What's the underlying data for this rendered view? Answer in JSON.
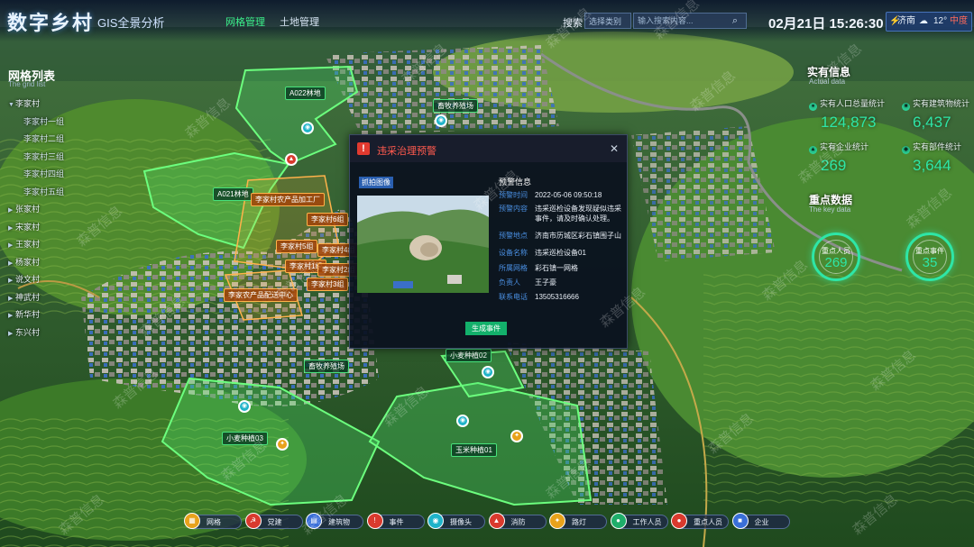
{
  "header": {
    "logo": "数字乡村",
    "subtitle": "GIS全景分析",
    "tabs": [
      {
        "label": "网格管理",
        "active": true
      },
      {
        "label": "土地管理",
        "active": false
      }
    ],
    "search": {
      "label": "搜索",
      "select_placeholder": "选择类别",
      "input_placeholder": "输入搜索内容..."
    },
    "datetime": "02月21日 15:26:30",
    "weather": {
      "city": "济南",
      "temp": "12°",
      "aqi": "中度"
    }
  },
  "left_panel": {
    "title": "网格列表",
    "subtitle": "The grid list",
    "items": [
      {
        "label": "李家村",
        "sub": false,
        "expanded": true
      },
      {
        "label": "李家村一组",
        "sub": true
      },
      {
        "label": "李家村二组",
        "sub": true
      },
      {
        "label": "李家村三组",
        "sub": true
      },
      {
        "label": "李家村四组",
        "sub": true
      },
      {
        "label": "李家村五组",
        "sub": true
      },
      {
        "label": "张家村",
        "sub": false
      },
      {
        "label": "宋家村",
        "sub": false
      },
      {
        "label": "王家村",
        "sub": false
      },
      {
        "label": "杨家村",
        "sub": false
      },
      {
        "label": "说文村",
        "sub": false
      },
      {
        "label": "神武村",
        "sub": false
      },
      {
        "label": "新华村",
        "sub": false
      },
      {
        "label": "东兴村",
        "sub": false
      }
    ]
  },
  "right_panel": {
    "actual_title": "实有信息",
    "actual_sub": "Actual data",
    "stats": [
      {
        "label": "实有人口总量统计",
        "value": "124,873",
        "icon": "people-icon"
      },
      {
        "label": "实有建筑物统计",
        "value": "6,437",
        "icon": "building-icon"
      },
      {
        "label": "实有企业统计",
        "value": "269",
        "icon": "company-icon"
      },
      {
        "label": "实有部件统计",
        "value": "3,644",
        "icon": "component-icon"
      }
    ],
    "key_title": "重点数据",
    "key_sub": "The key data",
    "key_rings": [
      {
        "label": "重点人员",
        "value": "269"
      },
      {
        "label": "重点事件",
        "value": "35"
      }
    ]
  },
  "map_labels": [
    {
      "text": "A022林地",
      "style": "green"
    },
    {
      "text": "畜牧养殖场",
      "style": "green"
    },
    {
      "text": "A021林地",
      "style": "green"
    },
    {
      "text": "李家村农产品加工厂",
      "style": "orange"
    },
    {
      "text": "李家村6组",
      "style": "orange"
    },
    {
      "text": "李家村5组",
      "style": "orange"
    },
    {
      "text": "李家村4组",
      "style": "orange"
    },
    {
      "text": "李家村1组",
      "style": "orange"
    },
    {
      "text": "李家村2组",
      "style": "orange"
    },
    {
      "text": "李家村3组",
      "style": "orange"
    },
    {
      "text": "李家农产品配送中心",
      "style": "orange"
    },
    {
      "text": "畜牧养殖场",
      "style": "green"
    },
    {
      "text": "小麦种植02",
      "style": "green"
    },
    {
      "text": "小麦种植03",
      "style": "green"
    },
    {
      "text": "玉米种植01",
      "style": "green"
    }
  ],
  "dialog": {
    "title": "违采治理预警",
    "photo_tag": "抓拍图像",
    "info_title": "预警信息",
    "rows": [
      {
        "key": "预警时间",
        "value": "2022-05-06  09:50:18"
      },
      {
        "key": "预警内容",
        "value": "违采巡检设备发现疑似违采事件，请及时确认处理。"
      },
      {
        "key": "预警地点",
        "value": "济南市历城区彩石镇围子山"
      },
      {
        "key": "设备名称",
        "value": "违采巡检设备01"
      },
      {
        "key": "所属网格",
        "value": "彩石镇一网格"
      },
      {
        "key": "负责人",
        "value": "王子豪"
      },
      {
        "key": "联系电话",
        "value": "13505316666"
      }
    ],
    "button": "生成事件"
  },
  "toolbar": [
    {
      "label": "网格",
      "color": "#e8a21b",
      "icon": "grid-icon",
      "glyph": "▦"
    },
    {
      "label": "党建",
      "color": "#d93a2e",
      "icon": "party-icon",
      "glyph": "☭"
    },
    {
      "label": "建筑物",
      "color": "#3a6fd8",
      "icon": "building-icon",
      "glyph": "▤"
    },
    {
      "label": "事件",
      "color": "#d93a2e",
      "icon": "event-icon",
      "glyph": "!"
    },
    {
      "label": "摄像头",
      "color": "#1fb3c9",
      "icon": "camera-icon",
      "glyph": "◉"
    },
    {
      "label": "消防",
      "color": "#d93a2e",
      "icon": "fire-icon",
      "glyph": "▲"
    },
    {
      "label": "路灯",
      "color": "#e8a21b",
      "icon": "streetlight-icon",
      "glyph": "✦"
    },
    {
      "label": "工作人员",
      "color": "#1fae6a",
      "icon": "staff-icon",
      "glyph": "●"
    },
    {
      "label": "重点人员",
      "color": "#d93a2e",
      "icon": "keyperson-icon",
      "glyph": "●"
    },
    {
      "label": "企业",
      "color": "#3a6fd8",
      "icon": "company-icon",
      "glyph": "■"
    }
  ],
  "watermark": "森普信息"
}
